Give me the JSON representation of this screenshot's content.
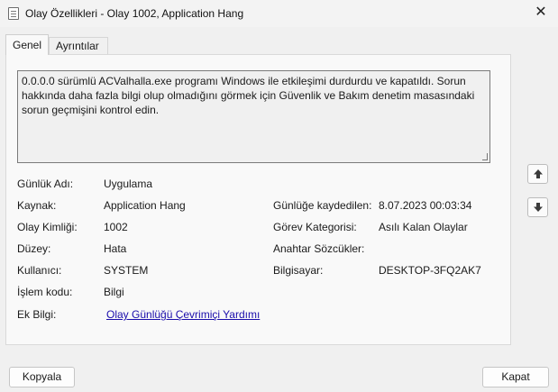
{
  "window": {
    "title": "Olay Özellikleri - Olay 1002, Application Hang",
    "close_glyph": "✕"
  },
  "tabs": [
    {
      "label": "Genel",
      "active": true
    },
    {
      "label": "Ayrıntılar",
      "active": false
    }
  ],
  "description": "0.0.0.0 sürümlü ACValhalla.exe programı Windows ile etkileşimi durdurdu ve kapatıldı. Sorun hakkında daha fazla bilgi olup olmadığını görmek için Güvenlik ve Bakım denetim masasındaki sorun geçmişini kontrol edin.",
  "fields": {
    "log_name": {
      "label": "Günlük Adı:",
      "value": "Uygulama"
    },
    "source": {
      "label": "Kaynak:",
      "value": "Application Hang"
    },
    "logged": {
      "label": "Günlüğe kaydedilen:",
      "value": "8.07.2023 00:03:34"
    },
    "event_id": {
      "label": "Olay Kimliği:",
      "value": "1002"
    },
    "task_category": {
      "label": "Görev Kategorisi:",
      "value": "Asılı Kalan Olaylar"
    },
    "level": {
      "label": "Düzey:",
      "value": "Hata"
    },
    "keywords": {
      "label": "Anahtar Sözcükler:",
      "value": ""
    },
    "user": {
      "label": "Kullanıcı:",
      "value": "SYSTEM"
    },
    "computer": {
      "label": "Bilgisayar:",
      "value": "DESKTOP-3FQ2AK7"
    },
    "opcode": {
      "label": "İşlem kodu:",
      "value": "Bilgi"
    },
    "more_info": {
      "label": "Ek Bilgi:",
      "link": "Olay Günlüğü Çevrimiçi Yardımı"
    }
  },
  "buttons": {
    "copy": "Kopyala",
    "close": "Kapat"
  },
  "icons": {
    "up": "arrow-up-icon",
    "down": "arrow-down-icon"
  }
}
